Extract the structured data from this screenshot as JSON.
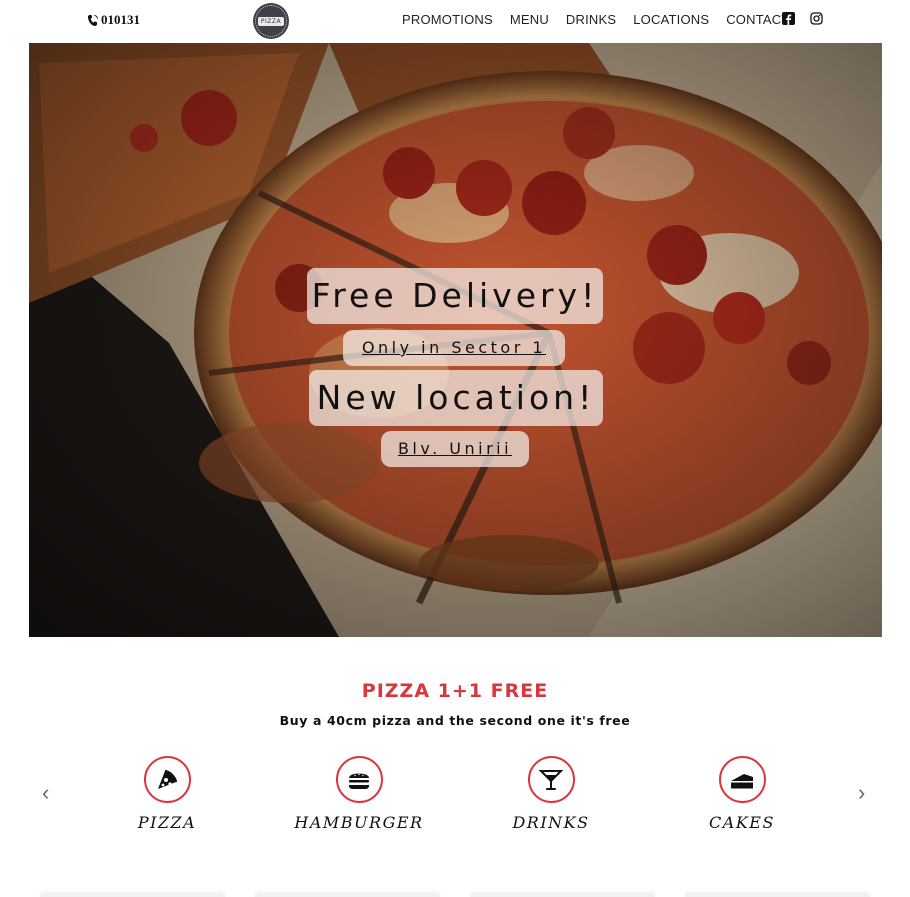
{
  "header": {
    "phone": "010131",
    "logo_text": "PIZZA",
    "nav": [
      "PROMOTIONS",
      "MENU",
      "DRINKS",
      "LOCATIONS",
      "CONTACT"
    ],
    "social": [
      "facebook-icon",
      "instagram-icon"
    ]
  },
  "hero": {
    "headline_1": "Free Delivery!",
    "sub_1": "Only in Sector 1",
    "headline_2": "New location!",
    "sub_2": "Blv. Unirii"
  },
  "promo": {
    "title": "PIZZA 1+1 FREE",
    "subtitle": "Buy a 40cm pizza and the second one it's free",
    "accent_color": "#d9363e"
  },
  "categories": {
    "prev": "‹",
    "next": "›",
    "items": [
      {
        "label": "PIZZA",
        "icon": "pizza-slice-icon"
      },
      {
        "label": "HAMBURGER",
        "icon": "hamburger-icon"
      },
      {
        "label": "DRINKS",
        "icon": "cocktail-icon"
      },
      {
        "label": "CAKES",
        "icon": "cake-icon"
      }
    ]
  }
}
